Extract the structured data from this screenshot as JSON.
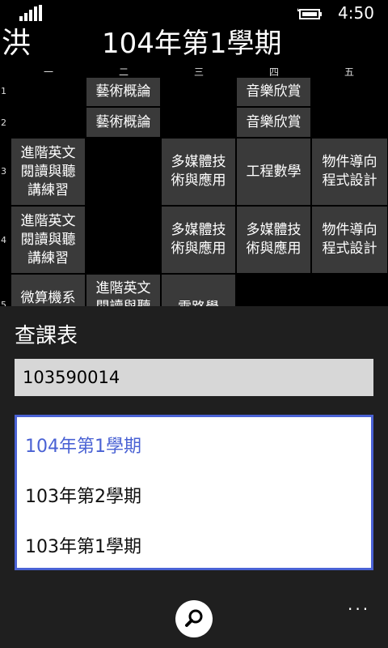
{
  "status": {
    "time": "4:50"
  },
  "title": {
    "left": "洪",
    "main": "104年第1學期"
  },
  "timetable": {
    "days": [
      "一",
      "二",
      "三",
      "四",
      "五"
    ],
    "periods": [
      "1",
      "2",
      "3",
      "4",
      "5"
    ],
    "cells": [
      {
        "text": "藝術概論"
      },
      {
        "text": "音樂欣賞"
      },
      {
        "text": "藝術概論"
      },
      {
        "text": "音樂欣賞"
      },
      {
        "text": "進階英文\n閱讀與聽\n講練習"
      },
      {
        "text": "多媒體技\n術與應用"
      },
      {
        "text": "工程數學"
      },
      {
        "text": "物件導向\n程式設計"
      },
      {
        "text": "進階英文\n閱讀與聽\n講練習"
      },
      {
        "text": "多媒體技\n術與應用"
      },
      {
        "text": "多媒體技\n術與應用"
      },
      {
        "text": "物件導向\n程式設計"
      },
      {
        "text": "微算機系"
      },
      {
        "text": "進階英文\n閱讀與聽"
      },
      {
        "text": "電路學"
      }
    ]
  },
  "panel": {
    "title": "查課表",
    "input_value": "103590014",
    "options": [
      "104年第1學期",
      "103年第2學期",
      "103年第1學期"
    ],
    "selected_index": 0,
    "accent_color": "#4a62d4"
  },
  "appbar": {
    "more": "..."
  }
}
